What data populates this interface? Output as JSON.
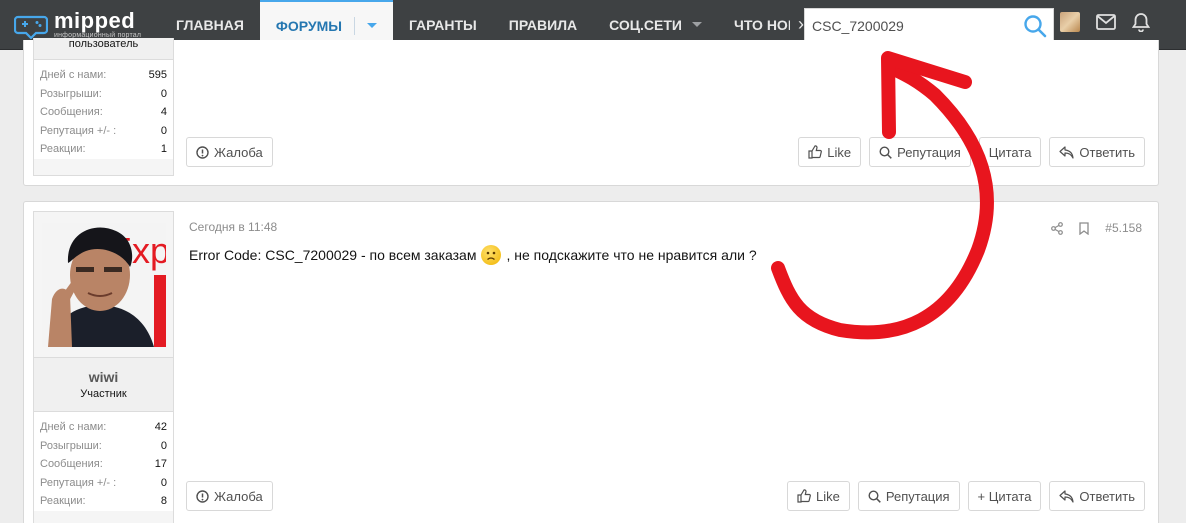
{
  "brand": {
    "name": "mipped",
    "tagline": "информационный портал",
    "accent": "#47a7eb",
    "nav_bg": "#3e4143"
  },
  "nav": {
    "items": [
      {
        "label": "ГЛАВНАЯ"
      },
      {
        "label": "ФОРУМЫ"
      },
      {
        "label": "ГАРАНТЫ"
      },
      {
        "label": "ПРАВИЛА"
      },
      {
        "label": "СОЦ.СЕТИ"
      },
      {
        "label": "ЧТО НОВ"
      }
    ],
    "more_glyph": "›"
  },
  "search": {
    "value": "CSC_7200029"
  },
  "posts": [
    {
      "user_title": "пользователь",
      "stats": [
        {
          "label": "Дней с нами:",
          "value": "595"
        },
        {
          "label": "Розыгрыши:",
          "value": "0"
        },
        {
          "label": "Сообщения:",
          "value": "4"
        },
        {
          "label": "Репутация +/- :",
          "value": "0"
        },
        {
          "label": "Реакции:",
          "value": "1"
        }
      ],
      "actions": {
        "report": "Жалоба",
        "like": "Like",
        "reputation": "Репутация",
        "quote": "Цитата",
        "reply": "Ответить"
      }
    },
    {
      "username": "wiwi",
      "user_title": "Участник",
      "time": "Сегодня в 11:48",
      "post_number": "#5.158",
      "message_part1": "Error Code: CSC_7200029 - по всем заказам",
      "message_part2": ", не подскажите что не нравится али ?",
      "stats": [
        {
          "label": "Дней с нами:",
          "value": "42"
        },
        {
          "label": "Розыгрыши:",
          "value": "0"
        },
        {
          "label": "Сообщения:",
          "value": "17"
        },
        {
          "label": "Репутация +/- :",
          "value": "0"
        },
        {
          "label": "Реакции:",
          "value": "8"
        }
      ],
      "actions": {
        "report": "Жалоба",
        "like": "Like",
        "reputation": "Репутация",
        "quote": "+ Цитата",
        "reply": "Ответить"
      },
      "avatar_text": "Exp"
    }
  ],
  "annotation_color": "#e8151e"
}
